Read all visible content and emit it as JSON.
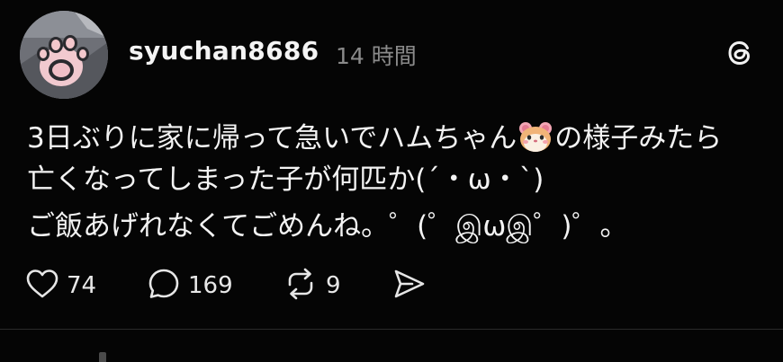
{
  "post": {
    "username": "syuchan8686",
    "timestamp": "14 時間",
    "body": {
      "line1_before": "3日ぶりに家に帰って急いでハムちゃん",
      "line1_emoji": "hamster-face-emoji",
      "line1_after": "の様子みたら",
      "line2": "亡くなってしまった子が何匹か(´・ω・`)",
      "line3": "ご飯あげれなくてごめんね。゜(゜இωஇ゜)゜。"
    },
    "actions": {
      "likes": "74",
      "replies": "169",
      "reposts": "9"
    },
    "icons": {
      "like": "heart-icon",
      "reply": "speech-bubble-icon",
      "repost": "repost-arrows-icon",
      "share": "send-icon",
      "brand": "threads-logo-icon"
    }
  }
}
